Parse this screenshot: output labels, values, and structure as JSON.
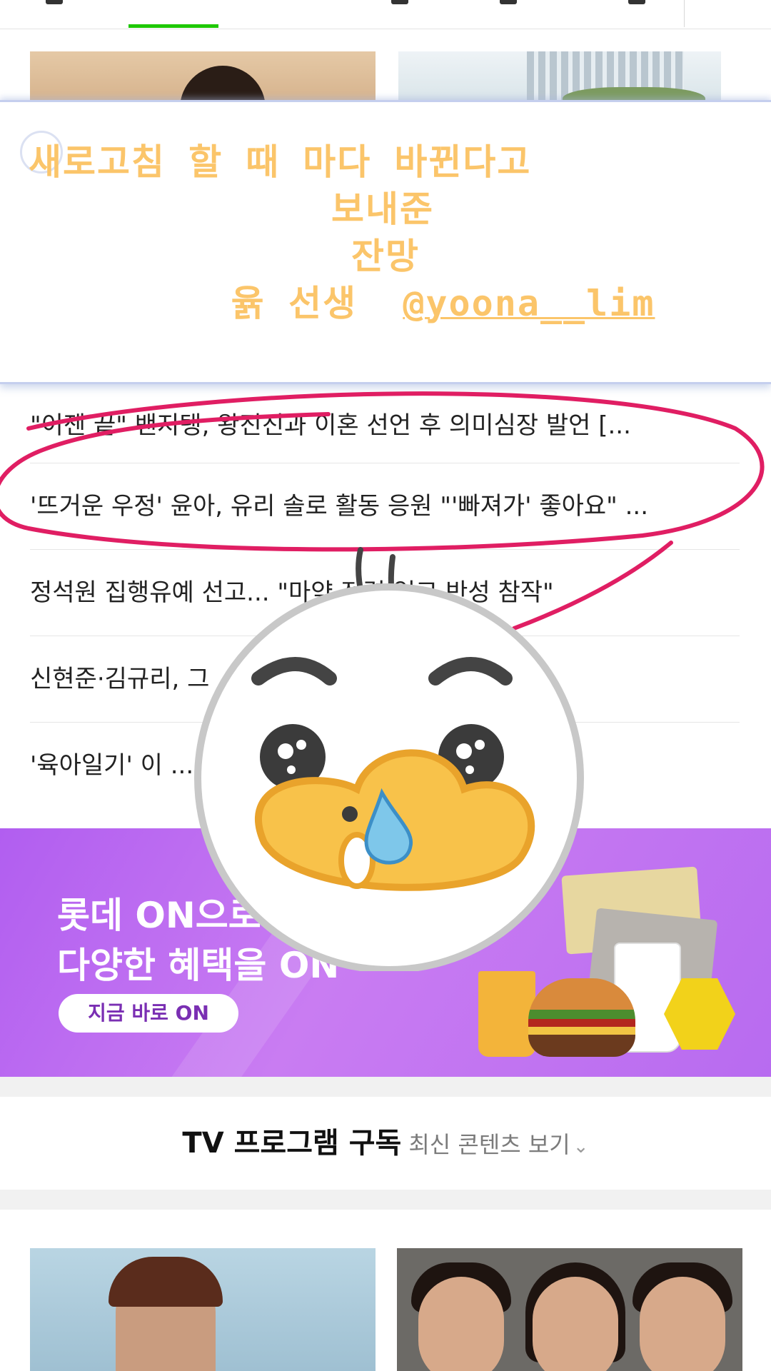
{
  "top_nav": {
    "active_tab_color": "#1ec800"
  },
  "sticker_note": {
    "line1": "새로고침 할 때 마다 바뀐다고",
    "line2": "보내준",
    "line3": "잔망",
    "line4_name": "윩 선생",
    "line4_mention": "@yoona__lim",
    "text_color": "#fbc56a"
  },
  "news": {
    "items": [
      "\"이젠 끝\" 밴지탱, 왕진진과 이혼 선언 후 의미심장 발언 [...",
      "'뜨거운 우정' 윤아, 유리 솔로 활동 응원 \"'빠져가' 좋아요\" ...",
      "정석원 집행유예 선고... \"마약 전력 없고 반성 참작\"",
      "신현준·김규리, 그 ... 로 낙점",
      "'육아일기' 이 ... x우정x..."
    ]
  },
  "ad": {
    "line1": "롯데 ON으로",
    "line2": "다양한 혜택을 ON",
    "cta_label": "지금 바로 ON",
    "background_color": "#b86bf0"
  },
  "tv_section": {
    "title": "TV 프로그램 구독",
    "subtitle": "최신 콘텐츠 보기",
    "chevron_icon": "chevron-down-icon"
  }
}
